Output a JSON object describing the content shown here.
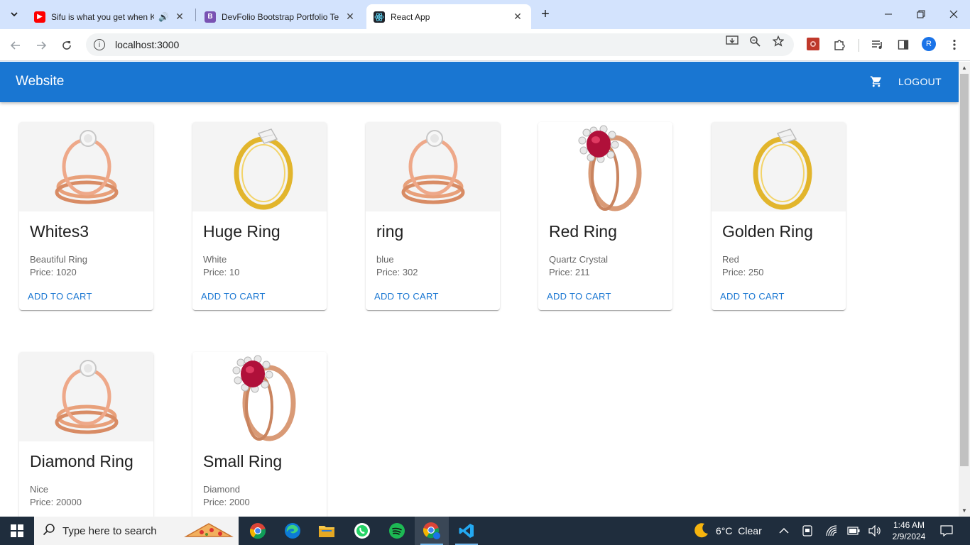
{
  "browser": {
    "tabs": [
      {
        "title": "Sifu is what you get when K",
        "favicon": "youtube-icon",
        "audio": true
      },
      {
        "title": "DevFolio Bootstrap Portfolio Te",
        "favicon": "bootstrap-icon"
      },
      {
        "title": "React App",
        "favicon": "react-icon",
        "active": true
      }
    ],
    "url": "localhost:3000",
    "profile_initial": "R"
  },
  "app": {
    "brand": "Website",
    "logout_label": "LOGOUT",
    "add_to_cart_label": "ADD TO CART",
    "price_prefix": "Price: ",
    "products": [
      {
        "name": "Whites3",
        "description": "Beautiful Ring",
        "price": "Price: 1020",
        "image": "rose-gold-halo-ring"
      },
      {
        "name": "Huge Ring",
        "description": "White",
        "price": "Price: 10",
        "image": "gold-solitaire-ring"
      },
      {
        "name": "ring",
        "description": "blue",
        "price": "Price: 302",
        "image": "rose-gold-halo-ring"
      },
      {
        "name": "Red Ring",
        "description": "Quartz Crystal",
        "price": "Price: 211",
        "image": "ruby-halo-ring"
      },
      {
        "name": "Golden Ring",
        "description": "Red",
        "price": "Price: 250",
        "image": "gold-solitaire-ring"
      },
      {
        "name": "Diamond Ring",
        "description": "Nice",
        "price": "Price: 20000",
        "image": "rose-gold-halo-ring"
      },
      {
        "name": "Small Ring",
        "description": "Diamond",
        "price": "Price: 2000",
        "image": "ruby-halo-ring"
      }
    ]
  },
  "taskbar": {
    "search_placeholder": "Type here to search",
    "weather": "6°C  Clear",
    "time": "1:46 AM",
    "date": "2/9/2024"
  },
  "colors": {
    "appbar": "#1976d2",
    "tabstrip": "#d3e3fd",
    "taskbar": "#1f2d3d"
  }
}
